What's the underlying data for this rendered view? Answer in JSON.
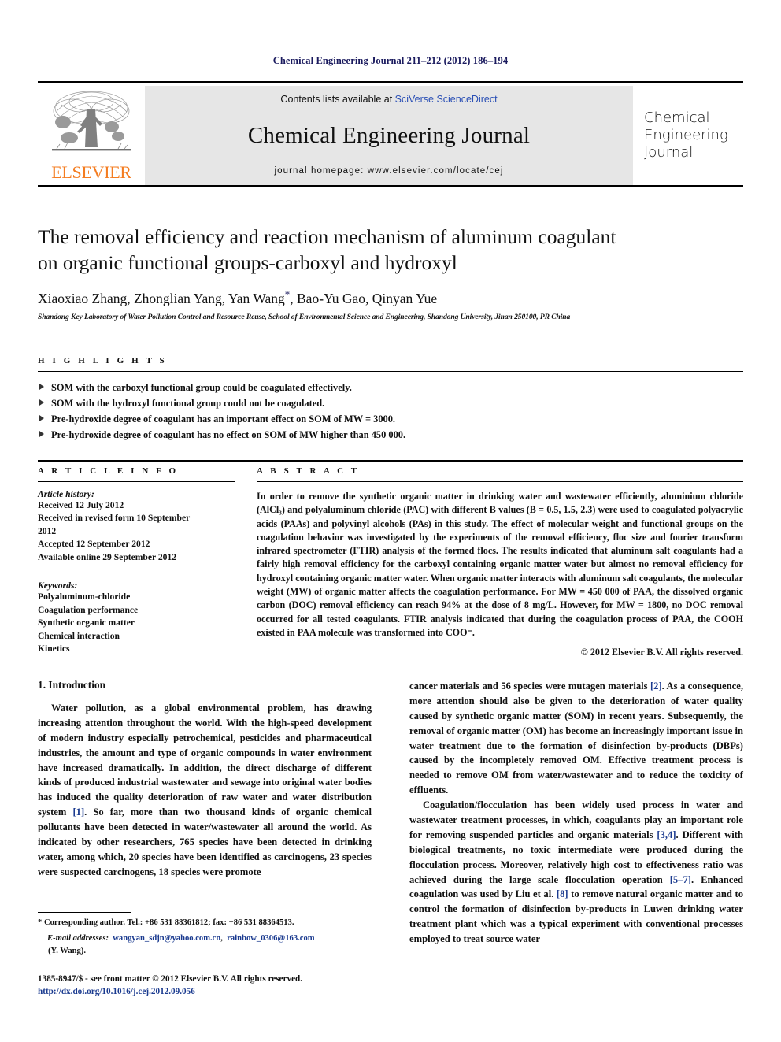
{
  "running_head": "Chemical Engineering Journal 211–212 (2012) 186–194",
  "masthead": {
    "contents_prefix": "Contents lists available at ",
    "sciencedirect": "SciVerse ScienceDirect",
    "journal_name": "Chemical Engineering Journal",
    "homepage": "journal homepage: www.elsevier.com/locate/cej",
    "publisher": "ELSEVIER",
    "cover_title_lines": [
      "Chemical",
      "Engineering",
      "Journal"
    ],
    "colors": {
      "link": "#2a4fb5",
      "elsevier_orange": "#F47C20",
      "panel_grey": "#e6e6e6"
    }
  },
  "article": {
    "title_line_1": "The removal efficiency and reaction mechanism of aluminum coagulant",
    "title_line_2": "on organic functional groups-carboxyl and hydroxyl",
    "authors": "Xiaoxiao Zhang, Zhonglian Yang, Yan Wang",
    "authors_tail": ", Bao-Yu Gao, Qinyan Yue",
    "corresponding_marker": "*",
    "affiliation": "Shandong Key Laboratory of Water Pollution Control and Resource Reuse, School of Environmental Science and Engineering, Shandong University, Jinan 250100, PR China"
  },
  "highlights": {
    "label": "H I G H L I G H T S",
    "items": [
      "SOM with the carboxyl functional group could be coagulated effectively.",
      "SOM with the hydroxyl functional group could not be coagulated.",
      "Pre-hydroxide degree of coagulant has an important effect on SOM of MW = 3000.",
      "Pre-hydroxide degree of coagulant has no effect on SOM of MW higher than 450 000."
    ]
  },
  "article_info": {
    "label": "A R T I C L E    I N F O",
    "history_head": "Article history:",
    "history_lines": [
      "Received 12 July 2012",
      "Received in revised form 10 September",
      "2012",
      "Accepted 12 September 2012",
      "Available online 29 September 2012"
    ],
    "keywords_head": "Keywords:",
    "keywords": [
      "Polyaluminum-chloride",
      "Coagulation performance",
      "Synthetic organic matter",
      "Chemical interaction",
      "Kinetics"
    ]
  },
  "abstract": {
    "label": "A B S T R A C T",
    "text": "In order to remove the synthetic organic matter in drinking water and wastewater efficiently, aluminium chloride (AlCl₃) and polyaluminum chloride (PAC) with different B values (B = 0.5, 1.5, 2.3) were used to coagulated polyacrylic acids (PAAs) and polyvinyl alcohols (PAs) in this study. The effect of molecular weight and functional groups on the coagulation behavior was investigated by the experiments of the removal efficiency, floc size and fourier transform infrared spectrometer (FTIR) analysis of the formed flocs. The results indicated that aluminum salt coagulants had a fairly high removal efficiency for the carboxyl containing organic matter water but almost no removal efficiency for hydroxyl containing organic matter water. When organic matter interacts with aluminum salt coagulants, the molecular weight (MW) of organic matter affects the coagulation performance. For MW = 450 000 of PAA, the dissolved organic carbon (DOC) removal efficiency can reach 94% at the dose of 8 mg/L. However, for MW = 1800, no DOC removal occurred for all tested coagulants. FTIR analysis indicated that during the coagulation process of PAA, the COOH existed in PAA molecule was transformed into COO⁻.",
    "copyright": "© 2012 Elsevier B.V. All rights reserved."
  },
  "introduction": {
    "heading": "1. Introduction",
    "left_para_1": "Water pollution, as a global environmental problem, has drawing increasing attention throughout the world. With the high-speed development of modern industry especially petrochemical, pesticides and pharmaceutical industries, the amount and type of organic compounds in water environment have increased dramatically. In addition, the direct discharge of different kinds of produced industrial wastewater and sewage into original water bodies has induced the quality deterioration of raw water and water distribution system ",
    "left_ref_1": "[1]",
    "left_para_1b": ". So far, more than two thousand kinds of organic chemical pollutants have been detected in water/wastewater all around the world. As indicated by other researchers, 765 species have been detected in drinking water, among which, 20 species have been identified as carcinogens, 23 species were suspected carcinogens, 18 species were promote",
    "right_para_1a": "cancer materials and 56 species were mutagen materials ",
    "right_ref_1": "[2]",
    "right_para_1b": ". As a consequence, more attention should also be given to the deterioration of water quality caused by synthetic organic matter (SOM) in recent years. Subsequently, the removal of organic matter (OM) has become an increasingly important issue in water treatment due to the formation of disinfection by-products (DBPs) caused by the incompletely removed OM. Effective treatment process is needed to remove OM from water/wastewater and to reduce the toxicity of effluents.",
    "right_para_2a": "Coagulation/flocculation has been widely used process in water and wastewater treatment processes, in which, coagulants play an important role for removing suspended particles and organic materials ",
    "right_ref_2": "[3,4]",
    "right_para_2b": ". Different with biological treatments, no toxic intermediate were produced during the flocculation process. Moreover, relatively high cost to effectiveness ratio was achieved during the large scale flocculation operation ",
    "right_ref_3": "[5–7]",
    "right_para_2c": ". Enhanced coagulation was used by Liu et al. ",
    "right_ref_4": "[8]",
    "right_para_2d": " to remove natural organic matter and to control the formation of disinfection by-products in Luwen drinking water treatment plant which was a typical experiment with conventional processes employed to treat source water"
  },
  "footnote": {
    "corresponding": "* Corresponding author. Tel.: +86 531 88361812; fax: +86 531 88364513.",
    "email_label": "E-mail addresses:",
    "email_1": "wangyan_sdjn@yahoo.com.cn",
    "email_2": "rainbow_0306@163.com",
    "email_attrib": "(Y. Wang)."
  },
  "colophon": {
    "issn_line": "1385-8947/$ - see front matter © 2012 Elsevier B.V. All rights reserved.",
    "doi": "http://dx.doi.org/10.1016/j.cej.2012.09.056"
  }
}
